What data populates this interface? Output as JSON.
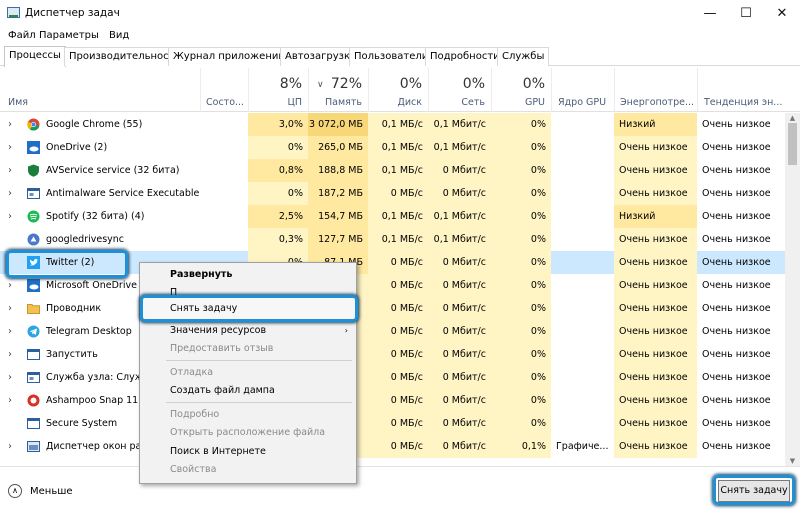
{
  "window": {
    "title": "Диспетчер задач",
    "minimize": "—",
    "maximize": "☐",
    "close": "✕"
  },
  "menu": [
    "Файл",
    "Параметры",
    "Вид"
  ],
  "tabs": [
    "Процессы",
    "Производительность",
    "Журнал приложений",
    "Автозагрузка",
    "Пользователи",
    "Подробности",
    "Службы"
  ],
  "header": {
    "name": "Имя",
    "status": "Состо...",
    "cpu_pct": "8%",
    "cpu": "ЦП",
    "mem_pct": "72%",
    "mem": "Память",
    "disk_pct": "0%",
    "disk": "Диск",
    "net_pct": "0%",
    "net": "Сеть",
    "gpu_pct": "0%",
    "gpu": "GPU",
    "gpu_engine": "Ядро GPU",
    "power": "Энергопотре...",
    "power_trend": "Тенденция эн..."
  },
  "rows": [
    {
      "name": "Google Chrome (55)",
      "cpu": "3,0%",
      "mem": "3 072,0 МБ",
      "disk": "0,1 МБ/с",
      "net": "0,1 Мбит/с",
      "gpu": "0%",
      "engine": "",
      "power": "Низкий",
      "trend": "Очень низкое",
      "icon": "chrome-icon"
    },
    {
      "name": "OneDrive (2)",
      "cpu": "0%",
      "mem": "265,0 МБ",
      "disk": "0,1 МБ/с",
      "net": "0,1 Мбит/с",
      "gpu": "0%",
      "engine": "",
      "power": "Очень низкое",
      "trend": "Очень низкое",
      "icon": "onedrive-icon"
    },
    {
      "name": "AVService service (32 бита)",
      "cpu": "0,8%",
      "mem": "188,8 МБ",
      "disk": "0,1 МБ/с",
      "net": "0 Мбит/с",
      "gpu": "0%",
      "engine": "",
      "power": "Очень низкое",
      "trend": "Очень низкое",
      "icon": "shield-icon"
    },
    {
      "name": "Antimalware Service Executable",
      "cpu": "0%",
      "mem": "187,2 МБ",
      "disk": "0 МБ/с",
      "net": "0 Мбит/с",
      "gpu": "0%",
      "engine": "",
      "power": "Очень низкое",
      "trend": "Очень низкое",
      "icon": "service-icon"
    },
    {
      "name": "Spotify (32 бита) (4)",
      "cpu": "2,5%",
      "mem": "154,7 МБ",
      "disk": "0,1 МБ/с",
      "net": "0,1 Мбит/с",
      "gpu": "0%",
      "engine": "",
      "power": "Низкий",
      "trend": "Очень низкое",
      "icon": "spotify-icon"
    },
    {
      "name": "googledrivesync",
      "cpu": "0,3%",
      "mem": "127,7 МБ",
      "disk": "0,1 МБ/с",
      "net": "0,1 Мбит/с",
      "gpu": "0%",
      "engine": "",
      "power": "Очень низкое",
      "trend": "Очень низкое",
      "icon": "drive-icon"
    },
    {
      "name": "Twitter (2)",
      "cpu": "0%",
      "mem": "87,1 МБ",
      "disk": "0 МБ/с",
      "net": "0 Мбит/с",
      "gpu": "0%",
      "engine": "",
      "power": "Очень низкое",
      "trend": "Очень низкое",
      "icon": "twitter-icon"
    },
    {
      "name": "Microsoft OneDrive (32 бита)",
      "cpu": "",
      "mem": "",
      "disk": "0 МБ/с",
      "net": "0 Мбит/с",
      "gpu": "0%",
      "engine": "",
      "power": "Очень низкое",
      "trend": "Очень низкое",
      "icon": "onedrive-icon"
    },
    {
      "name": "Проводник",
      "cpu": "",
      "mem": "",
      "disk": "0 МБ/с",
      "net": "0 Мбит/с",
      "gpu": "0%",
      "engine": "",
      "power": "Очень низкое",
      "trend": "Очень низкое",
      "icon": "folder-icon"
    },
    {
      "name": "Telegram Desktop",
      "cpu": "",
      "mem": "",
      "disk": "0 МБ/с",
      "net": "0 Мбит/с",
      "gpu": "0%",
      "engine": "",
      "power": "Очень низкое",
      "trend": "Очень низкое",
      "icon": "telegram-icon"
    },
    {
      "name": "Запустить",
      "cpu": "",
      "mem": "",
      "disk": "0 МБ/с",
      "net": "0 Мбит/с",
      "gpu": "0%",
      "engine": "",
      "power": "Очень низкое",
      "trend": "Очень низкое",
      "icon": "app-icon"
    },
    {
      "name": "Служба узла: Служб",
      "cpu": "",
      "mem": "",
      "disk": "0 МБ/с",
      "net": "0 Мбит/с",
      "gpu": "0%",
      "engine": "",
      "power": "Очень низкое",
      "trend": "Очень низкое",
      "icon": "service-icon"
    },
    {
      "name": "Ashampoo Snap 11 (3",
      "cpu": "",
      "mem": "",
      "disk": "0 МБ/с",
      "net": "0 Мбит/с",
      "gpu": "0%",
      "engine": "",
      "power": "Очень низкое",
      "trend": "Очень низкое",
      "icon": "ashampoo-icon"
    },
    {
      "name": "Secure System",
      "cpu": "",
      "mem": "",
      "disk": "0 МБ/с",
      "net": "0 Мбит/с",
      "gpu": "0%",
      "engine": "",
      "power": "Очень низкое",
      "trend": "Очень низкое",
      "icon": "secure-icon"
    },
    {
      "name": "Диспетчер окон раб",
      "cpu": "",
      "mem": "",
      "disk": "0 МБ/с",
      "net": "0 Мбит/с",
      "gpu": "0,1%",
      "engine": "Графиче...",
      "power": "Очень низкое",
      "trend": "Очень низкое",
      "icon": "dwm-icon"
    }
  ],
  "context_menu": {
    "expand": "Развернуть",
    "switch_to": "П",
    "end_task": "Снять задачу",
    "resource_values": "Значения ресурсов",
    "submenu_arrow": "›",
    "feedback": "Предоставить отзыв",
    "debug": "Отладка",
    "dump": "Создать файл дампа",
    "details": "Подробно",
    "open_location": "Открыть расположение файла",
    "search_online": "Поиск в Интернете",
    "properties": "Свойства"
  },
  "footer": {
    "less": "Меньше",
    "end_task": "Снять задачу"
  },
  "colors": {
    "heat_light": "#fff4c4",
    "heat_mid": "#ffe8a0",
    "heat_strong": "#f8d779",
    "selection": "#cce8ff",
    "highlight": "#1f8fd6"
  }
}
